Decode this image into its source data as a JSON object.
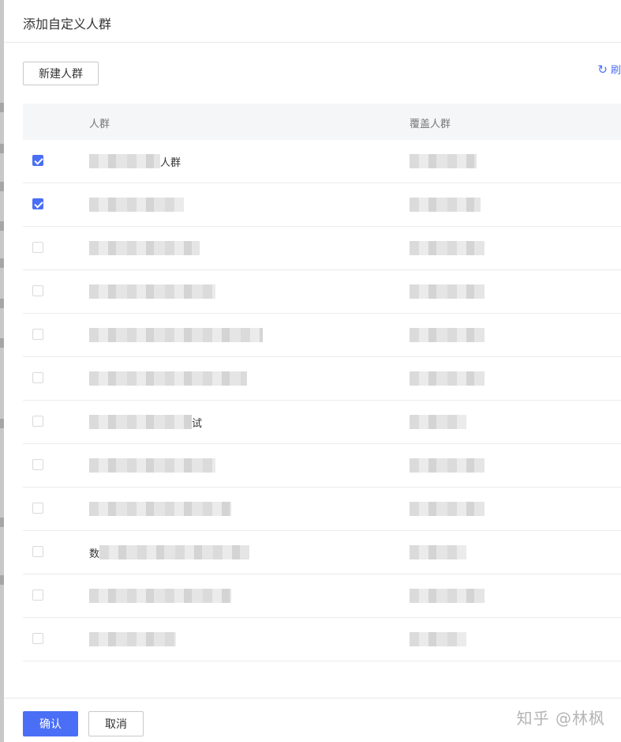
{
  "dialog": {
    "title": "添加自定义人群",
    "new_group_label": "新建人群",
    "refresh_label": "刷",
    "refresh_icon": "refresh-icon"
  },
  "table": {
    "headers": [
      "人群",
      "覆盖人群"
    ],
    "rows": [
      {
        "checked": true,
        "name_visible": "人群",
        "name_redacted": true,
        "coverage_redacted": true
      },
      {
        "checked": true,
        "name_visible": "",
        "name_redacted": true,
        "coverage_redacted": true
      },
      {
        "checked": false,
        "name_visible": "",
        "name_redacted": true,
        "coverage_redacted": true
      },
      {
        "checked": false,
        "name_visible": "",
        "name_redacted": true,
        "coverage_redacted": true
      },
      {
        "checked": false,
        "name_visible": "",
        "name_redacted": true,
        "coverage_redacted": true
      },
      {
        "checked": false,
        "name_visible": "",
        "name_redacted": true,
        "coverage_redacted": true
      },
      {
        "checked": false,
        "name_visible": "试",
        "name_redacted": true,
        "coverage_redacted": true
      },
      {
        "checked": false,
        "name_visible": "",
        "name_redacted": true,
        "coverage_redacted": true
      },
      {
        "checked": false,
        "name_visible": "",
        "name_redacted": true,
        "coverage_redacted": true
      },
      {
        "checked": false,
        "name_visible": "数",
        "name_redacted": true,
        "coverage_redacted": true
      },
      {
        "checked": false,
        "name_visible": "",
        "name_redacted": true,
        "coverage_redacted": true
      },
      {
        "checked": false,
        "name_visible": "",
        "name_redacted": true,
        "coverage_redacted": true
      }
    ]
  },
  "footer": {
    "confirm_label": "确认",
    "cancel_label": "取消"
  },
  "watermark": "知乎 @林枫",
  "colors": {
    "accent": "#4a6ef5",
    "header_bg": "#f5f6f7",
    "divider": "#ebebeb"
  }
}
